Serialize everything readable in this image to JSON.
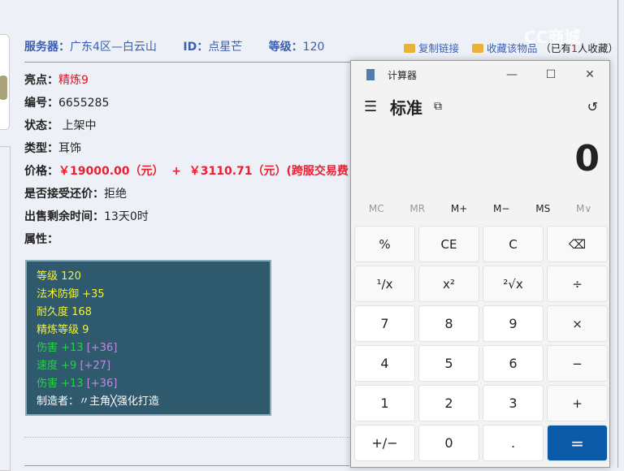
{
  "header": {
    "server_label": "服务器：",
    "server": "广东4区—白云山",
    "id_label": "ID：",
    "id": "点星芒",
    "level_label": "等级：",
    "level": "120"
  },
  "links": {
    "copy": "复制链接",
    "favorite": "收藏该物品",
    "count_pre": "（已有",
    "count": "1",
    "count_post": "人收藏）"
  },
  "watermark": "CC商城",
  "rows": [
    {
      "label": "亮点：",
      "value": "精炼9"
    },
    {
      "label": "编号：",
      "value": "6655285"
    },
    {
      "label": "状态：",
      "value": " 上架中"
    },
    {
      "label": "类型：",
      "value": "耳饰"
    },
    {
      "label": "价格：",
      "value": "￥19000.00（元）  +  ￥3110.71（元）(跨服交易费"
    },
    {
      "label": "是否接受还价：",
      "value": "拒绝"
    },
    {
      "label": "出售剩余时间：",
      "value": "13天0时"
    },
    {
      "label": "属性：",
      "value": ""
    }
  ],
  "attributes": [
    {
      "text": "等级 120",
      "extra": ""
    },
    {
      "text": "法术防御 +35",
      "extra": ""
    },
    {
      "text": "耐久度 168",
      "extra": ""
    },
    {
      "text": "精炼等级 9",
      "extra": ""
    },
    {
      "text": "伤害 +13 ",
      "extra": "[+36]"
    },
    {
      "text": "速度 +9 ",
      "extra": "[+27]"
    },
    {
      "text": "伤害 +13 ",
      "extra": "[+36]"
    },
    {
      "text": "制造者：〃主角╳强化打造",
      "extra": ""
    }
  ],
  "calc": {
    "title": "计算器",
    "mode": "标准",
    "display": "0",
    "memory": [
      "MC",
      "MR",
      "M+",
      "M−",
      "MS",
      "M∨"
    ],
    "keys": [
      "%",
      "CE",
      "C",
      "⌫",
      "¹/x",
      "x²",
      "²√x",
      "÷",
      "7",
      "8",
      "9",
      "×",
      "4",
      "5",
      "6",
      "−",
      "1",
      "2",
      "3",
      "+",
      "+/−",
      "0",
      ".",
      "="
    ]
  }
}
